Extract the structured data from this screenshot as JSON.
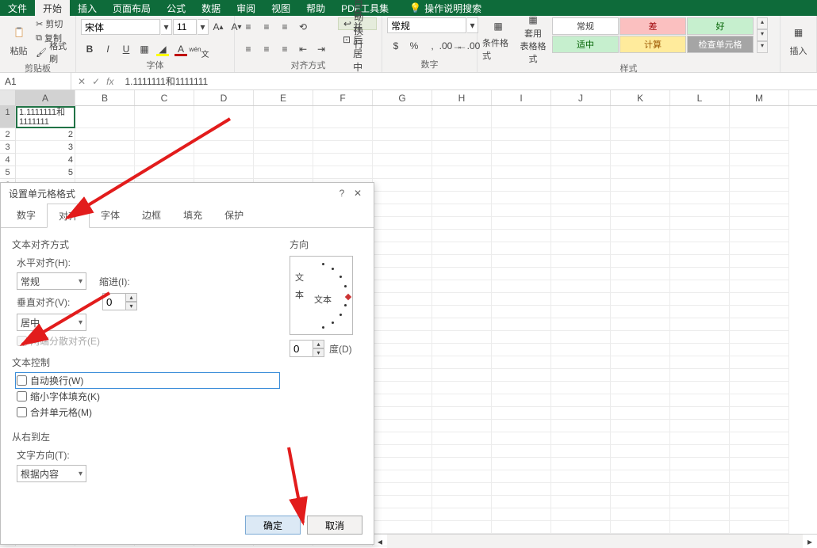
{
  "menubar": {
    "file": "文件",
    "home": "开始",
    "insert": "插入",
    "pagelayout": "页面布局",
    "formulas": "公式",
    "data": "数据",
    "review": "审阅",
    "view": "视图",
    "help": "帮助",
    "pdf": "PDF工具集",
    "search_hint": "操作说明搜索"
  },
  "ribbon": {
    "clipboard": {
      "paste": "粘贴",
      "cut": "剪切",
      "copy": "复制",
      "format_painter": "格式刷",
      "label": "剪贴板"
    },
    "font": {
      "name": "宋体",
      "size": "11",
      "label": "字体"
    },
    "alignment": {
      "wrap": "自动换行",
      "merge": "合并后居中",
      "label": "对齐方式"
    },
    "number": {
      "format": "常规",
      "label": "数字"
    },
    "styles": {
      "conditional": "条件格式",
      "as_table": "套用\n表格格式",
      "normal": "常规",
      "bad": "差",
      "good": "好",
      "neutral": "适中",
      "calc": "计算",
      "check": "检查单元格",
      "label": "样式"
    },
    "cells": {
      "insert": "插入"
    }
  },
  "formula_bar": {
    "cell_ref": "A1",
    "fx": "fx",
    "value": "1.1111111和1111111"
  },
  "grid": {
    "columns": [
      "A",
      "B",
      "C",
      "D",
      "E",
      "F",
      "G",
      "H",
      "I",
      "J",
      "K",
      "L",
      "M"
    ],
    "rows": [
      {
        "num": "1",
        "a": "1.1111111和1111111"
      },
      {
        "num": "2",
        "a": "2"
      },
      {
        "num": "3",
        "a": "3"
      },
      {
        "num": "4",
        "a": "4"
      },
      {
        "num": "5",
        "a": "5"
      }
    ]
  },
  "dialog": {
    "title": "设置单元格格式",
    "tabs": {
      "number": "数字",
      "alignment": "对齐",
      "font": "字体",
      "border": "边框",
      "fill": "填充",
      "protection": "保护"
    },
    "active_tab": "alignment",
    "align_section": "文本对齐方式",
    "h_align_label": "水平对齐(H):",
    "h_align_value": "常规",
    "indent_label": "缩进(I):",
    "indent_value": "0",
    "v_align_label": "垂直对齐(V):",
    "v_align_value": "居中",
    "justify_distributed": "两端分散对齐(E)",
    "text_control_section": "文本控制",
    "wrap_text": "自动换行(W)",
    "shrink_to_fit": "缩小字体填充(K)",
    "merge_cells": "合并单元格(M)",
    "rtl_section": "从右到左",
    "text_dir_label": "文字方向(T):",
    "text_dir_value": "根据内容",
    "orientation_label": "方向",
    "orient_text_v": "文本",
    "orient_text_h": "文本",
    "degrees_value": "0",
    "degrees_label": "度(D)",
    "ok": "确定",
    "cancel": "取消"
  }
}
